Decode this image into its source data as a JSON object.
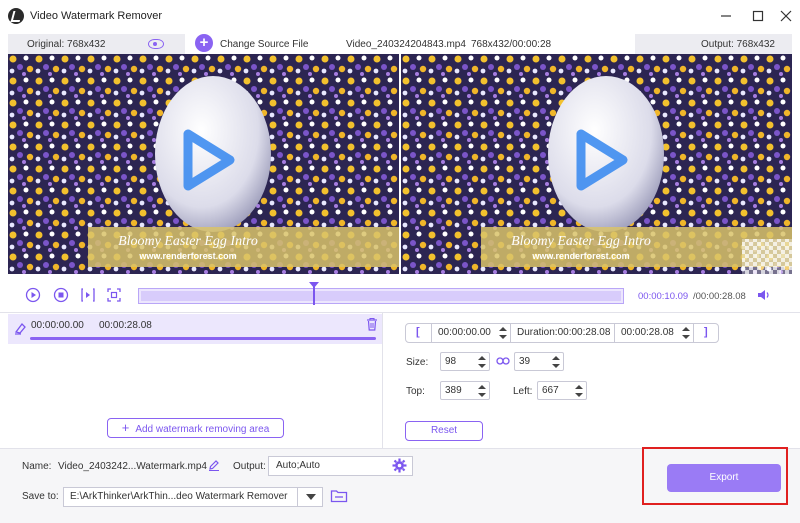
{
  "window": {
    "title": "Video Watermark Remover",
    "minimize_icon": "minimize-icon",
    "maximize_icon": "maximize-icon",
    "close_icon": "close-icon"
  },
  "infobar": {
    "original": "Original: 768x432",
    "change_source": "Change Source File",
    "file_name": "Video_240324204843.mp4",
    "file_meta": "768x432/00:00:28",
    "output": "Output: 768x432"
  },
  "preview": {
    "caption_title": "Bloomy Easter Egg Intro",
    "caption_url": "www.renderforest.com"
  },
  "playback": {
    "current_time": "00:00:10.09",
    "total_time": "/00:00:28.08",
    "progress": 0.36
  },
  "segment": {
    "start": "00:00:00.00",
    "end": "00:00:28.08",
    "add_area_label": "Add watermark removing area"
  },
  "area": {
    "start_time": "00:00:00.00",
    "duration": "Duration:00:00:28.08",
    "end_time": "00:00:28.08",
    "size_label": "Size:",
    "width": "98",
    "height": "39",
    "top_label": "Top:",
    "top": "389",
    "left_label": "Left:",
    "left": "667",
    "reset_label": "Reset"
  },
  "bottom": {
    "name_label": "Name:",
    "name_value": "Video_2403242...Watermark.mp4",
    "output_label": "Output:",
    "output_value": "Auto;Auto",
    "save_label": "Save to:",
    "save_value": "E:\\ArkThinker\\ArkThin...deo Watermark Remover",
    "export_label": "Export"
  },
  "colors": {
    "accent": "#8a63f2",
    "highlight": "#e02020"
  }
}
